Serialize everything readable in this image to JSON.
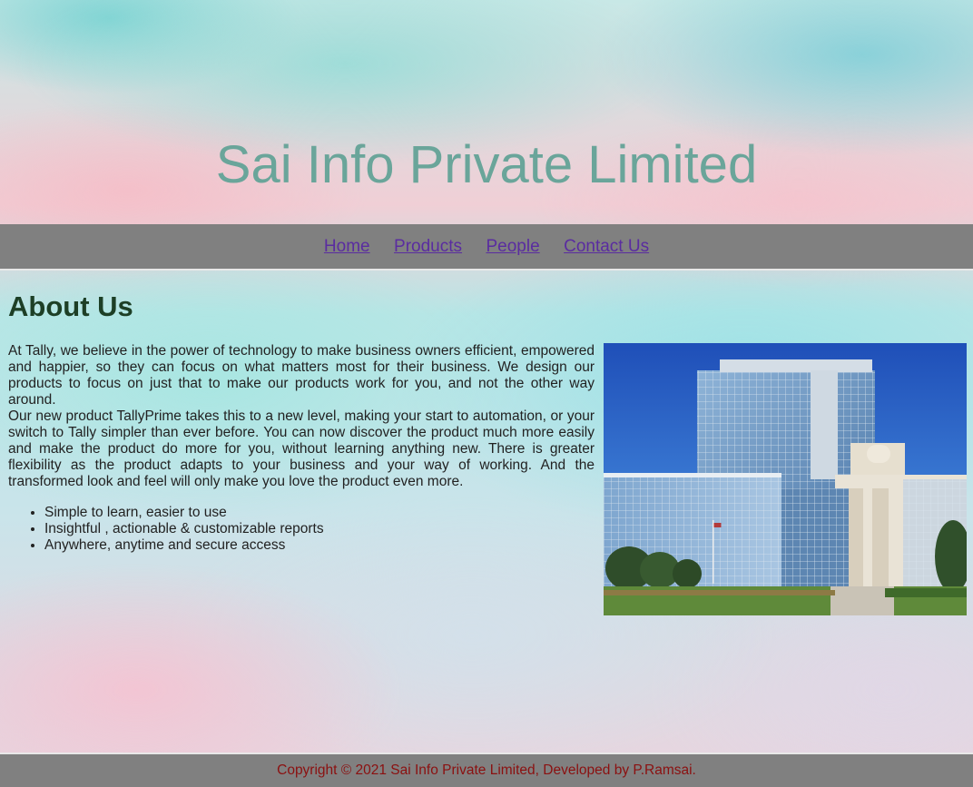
{
  "header": {
    "title": "Sai Info Private Limited"
  },
  "nav": {
    "items": [
      {
        "label": "Home"
      },
      {
        "label": "Products"
      },
      {
        "label": "People"
      },
      {
        "label": "Contact Us"
      }
    ]
  },
  "about": {
    "heading": "About Us",
    "paragraph1": "At Tally, we believe in the power of technology to make business owners efficient, empowered and happier, so they can focus on what matters most for their business. We design our products to focus on just that to make our products work for you, and not the other way around.",
    "paragraph2": "Our new product TallyPrime takes this to a new level, making your start to automation, or your switch to Tally simpler than ever before. You can now discover the product much more easily and make the product do more for you, without learning anything new. There is greater flexibility as the product adapts to your business and your way of working. And the transformed look and feel will only make you love the product even more.",
    "features": [
      "Simple to learn, easier to use",
      "Insightful , actionable & customizable reports",
      "Anywhere, anytime and secure access"
    ]
  },
  "footer": {
    "copyright": "Copyright © 2021 Sai Info Private Limited, Developed by P.Ramsai."
  },
  "colors": {
    "title": "#6aa59a",
    "nav_bg": "#808080",
    "nav_link": "#5a2ca0",
    "heading": "#1d3f26",
    "footer_text": "#8b1010"
  }
}
